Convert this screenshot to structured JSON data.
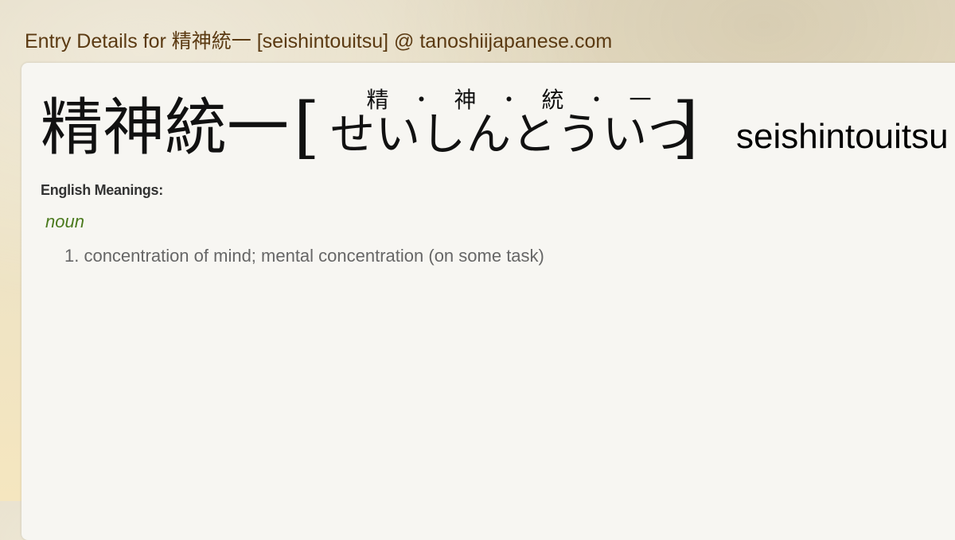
{
  "page": {
    "title": "Entry Details for 精神統一 [seishintouitsu] @ tanoshiijapanese.com"
  },
  "entry": {
    "kanji": "精神統一",
    "bracket_open": "[",
    "bracket_close": "]",
    "furigana": [
      "精",
      "・",
      "神",
      "・",
      "統",
      "・",
      "一"
    ],
    "kana": "せいしんとういつ",
    "romaji": "seishintouitsu"
  },
  "meanings": {
    "label": "English Meanings:",
    "part_of_speech": "noun",
    "items": [
      "1. concentration of mind; mental concentration (on some task)"
    ]
  },
  "colors": {
    "title": "#5b3a12",
    "part_of_speech": "#4b7a1e",
    "meaning_text": "#666666",
    "card_background": "#f7f6f2"
  }
}
